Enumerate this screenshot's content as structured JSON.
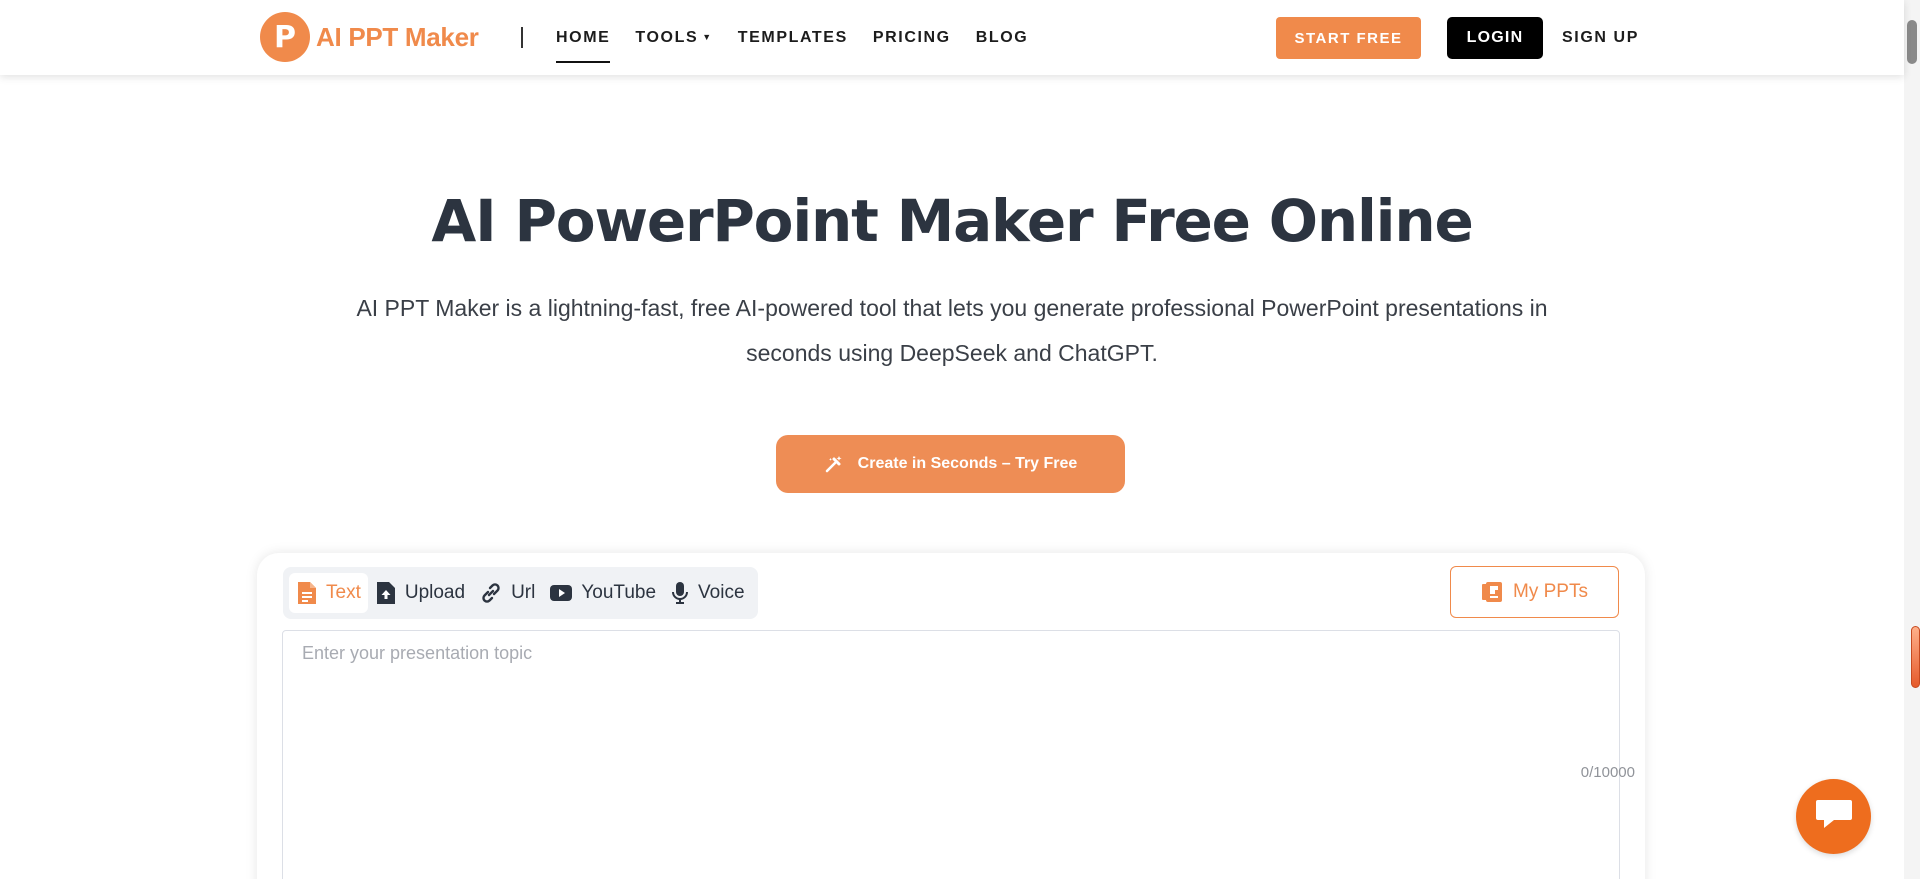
{
  "header": {
    "logo_letter": "P",
    "logo_text": "AI PPT Maker",
    "nav": [
      {
        "label": "HOME",
        "active": true
      },
      {
        "label": "TOOLS",
        "has_dropdown": true
      },
      {
        "label": "TEMPLATES"
      },
      {
        "label": "PRICING"
      },
      {
        "label": "BLOG"
      }
    ],
    "start_label": "START FREE",
    "login_label": "LOGIN",
    "signup_label": "SIGN UP"
  },
  "hero": {
    "title": "AI PowerPoint Maker Free Online",
    "description": "AI PPT Maker is a lightning-fast, free AI-powered tool that lets you generate professional PowerPoint presentations in seconds using DeepSeek and ChatGPT.",
    "cta_label": "Create in Seconds – Try Free"
  },
  "input_card": {
    "tabs": [
      {
        "label": "Text",
        "icon": "document-icon",
        "active": true
      },
      {
        "label": "Upload",
        "icon": "upload-icon"
      },
      {
        "label": "Url",
        "icon": "link-icon"
      },
      {
        "label": "YouTube",
        "icon": "youtube-icon"
      },
      {
        "label": "Voice",
        "icon": "microphone-icon"
      }
    ],
    "my_ppts_label": "My PPTs",
    "topic_placeholder": "Enter your presentation topic",
    "topic_value": "",
    "char_count": "0/10000"
  },
  "colors": {
    "brand": "#f08a4b",
    "cta": "#ee8d55",
    "chat": "#ee6d1e",
    "login_bg": "#000000",
    "title_text": "#2c3440"
  }
}
